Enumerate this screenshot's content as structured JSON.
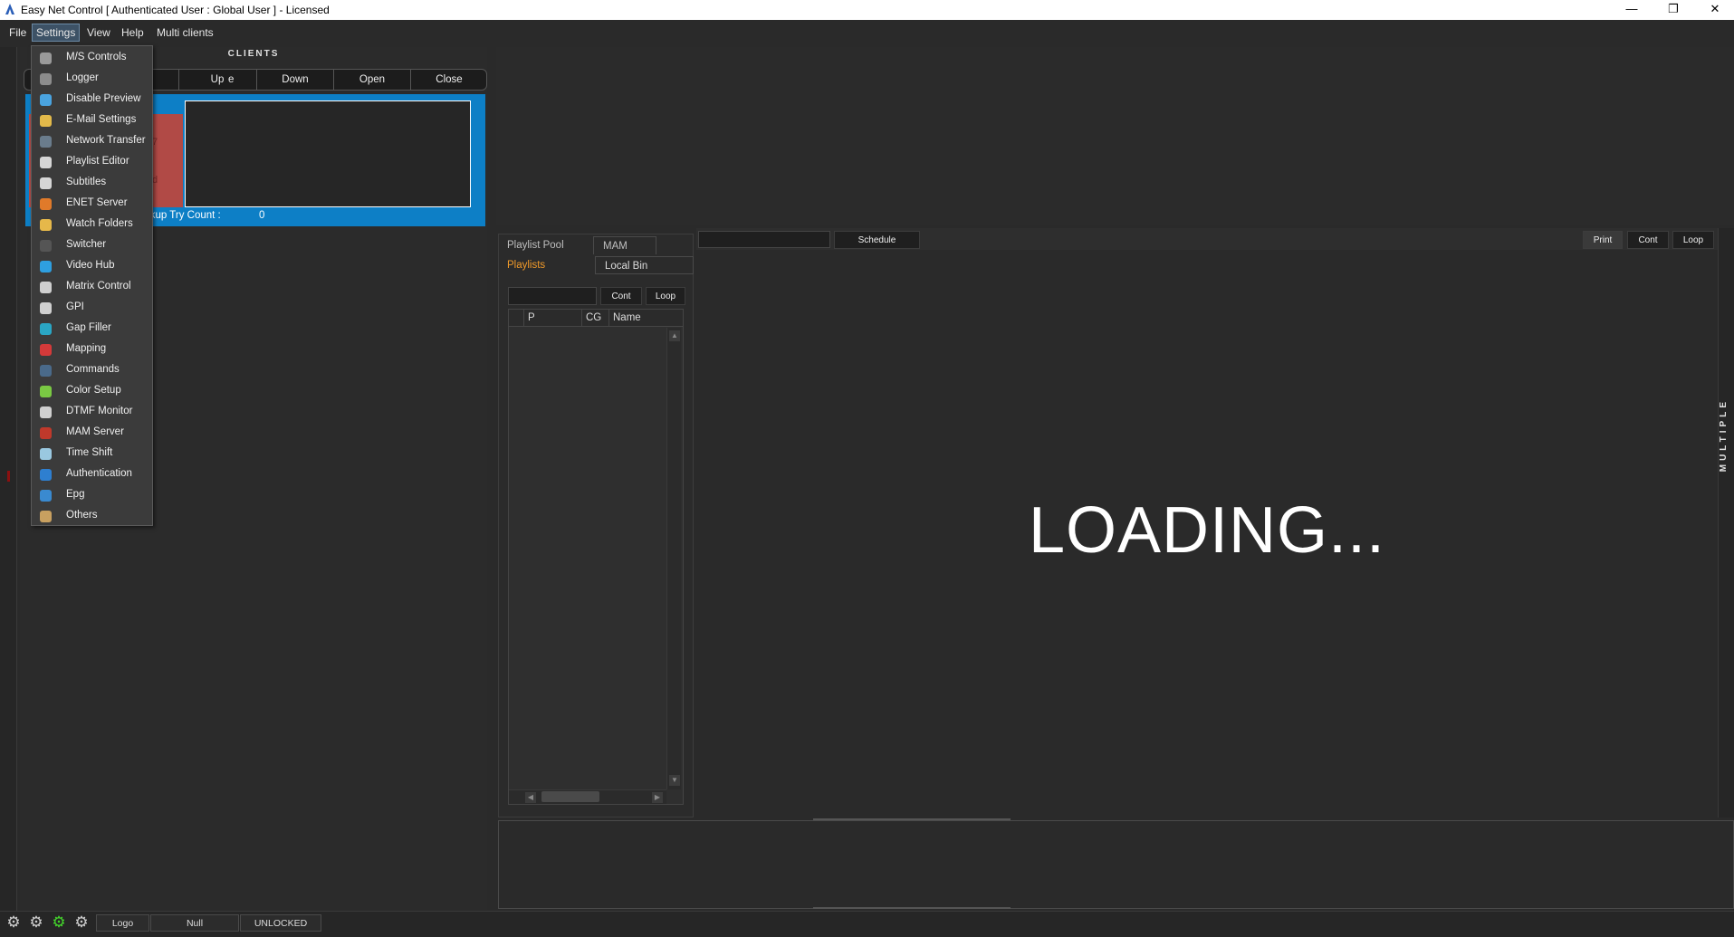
{
  "window": {
    "title": "Easy Net Control  [ Authenticated User : Global User ] - Licensed",
    "minimize": "—",
    "restore": "❐",
    "close": "✕"
  },
  "menubar": {
    "items": [
      "File",
      "Settings",
      "View",
      "Help",
      "Multi clients"
    ]
  },
  "settings_menu": {
    "items": [
      {
        "label": "M/S Controls",
        "icon": "sliders-icon",
        "color": "#9a9a9a"
      },
      {
        "label": "Logger",
        "icon": "logger-icon",
        "color": "#8c8c8c"
      },
      {
        "label": "Disable Preview",
        "icon": "preview-icon",
        "color": "#4aa3df"
      },
      {
        "label": "E-Mail Settings",
        "icon": "email-icon",
        "color": "#e2b94a"
      },
      {
        "label": "Network Transfer",
        "icon": "network-icon",
        "color": "#6a7c8c"
      },
      {
        "label": "Playlist Editor",
        "icon": "list-icon",
        "color": "#d6d6d6"
      },
      {
        "label": "Subtitles",
        "icon": "subtitles-icon",
        "color": "#d6d6d6"
      },
      {
        "label": "ENET Server",
        "icon": "server-icon",
        "color": "#e07a2a"
      },
      {
        "label": "Watch Folders",
        "icon": "folder-icon",
        "color": "#e6b84a"
      },
      {
        "label": "Switcher",
        "icon": "switcher-icon",
        "color": "#555555"
      },
      {
        "label": "Video Hub",
        "icon": "video-hub-icon",
        "color": "#2e9fe0"
      },
      {
        "label": "Matrix Control",
        "icon": "matrix-icon",
        "color": "#cfcfcf"
      },
      {
        "label": "GPI",
        "icon": "gpi-icon",
        "color": "#cfcfcf"
      },
      {
        "label": "Gap Filler",
        "icon": "gap-filler-icon",
        "color": "#2aa6c4"
      },
      {
        "label": "Mapping",
        "icon": "map-pin-icon",
        "color": "#d43a3a"
      },
      {
        "label": "Commands",
        "icon": "commands-icon",
        "color": "#4a6a8a"
      },
      {
        "label": "Color Setup",
        "icon": "color-setup-icon",
        "color": "#7ac943"
      },
      {
        "label": "DTMF Monitor",
        "icon": "dtmf-icon",
        "color": "#cfcfcf"
      },
      {
        "label": "MAM Server",
        "icon": "mam-server-icon",
        "color": "#c0392b"
      },
      {
        "label": "Time Shift",
        "icon": "time-shift-icon",
        "color": "#9ac8e0"
      },
      {
        "label": "Authentication",
        "icon": "lock-icon",
        "color": "#2e7fd0"
      },
      {
        "label": "Epg",
        "icon": "epg-icon",
        "color": "#3a8ad0"
      },
      {
        "label": "Others",
        "icon": "others-icon",
        "color": "#c8a060"
      }
    ]
  },
  "clients": {
    "header": "CLIENTS",
    "buttons": [
      "e",
      "Up",
      "Down",
      "Open",
      "Close"
    ],
    "backup_label": "ckup Try Count :",
    "backup_value": "0",
    "thumb_frag_1": "7",
    "thumb_frag_2": "d"
  },
  "playlist_panel": {
    "tabs": {
      "playlist_pool": "Playlist Pool",
      "mam": "MAM",
      "playlists": "Playlists",
      "local_bin": "Local Bin"
    },
    "cont": "Cont",
    "loop": "Loop",
    "columns": [
      "P",
      "CG",
      "Name"
    ]
  },
  "main": {
    "schedule": "Schedule",
    "print": "Print",
    "cont": "Cont",
    "loop": "Loop",
    "loading": "LOADING...",
    "side_label": "MULTIPLE"
  },
  "statusbar": {
    "cells": [
      "Logo",
      "Null",
      "UNLOCKED"
    ],
    "gear_colors": [
      "#cfcfcf",
      "#cfcfcf",
      "#44d62c",
      "#cfcfcf"
    ]
  },
  "colors": {
    "accent_blue": "#0d7fc6",
    "tab_active": "#f09a2a",
    "client_thumb": "#b14a46"
  }
}
